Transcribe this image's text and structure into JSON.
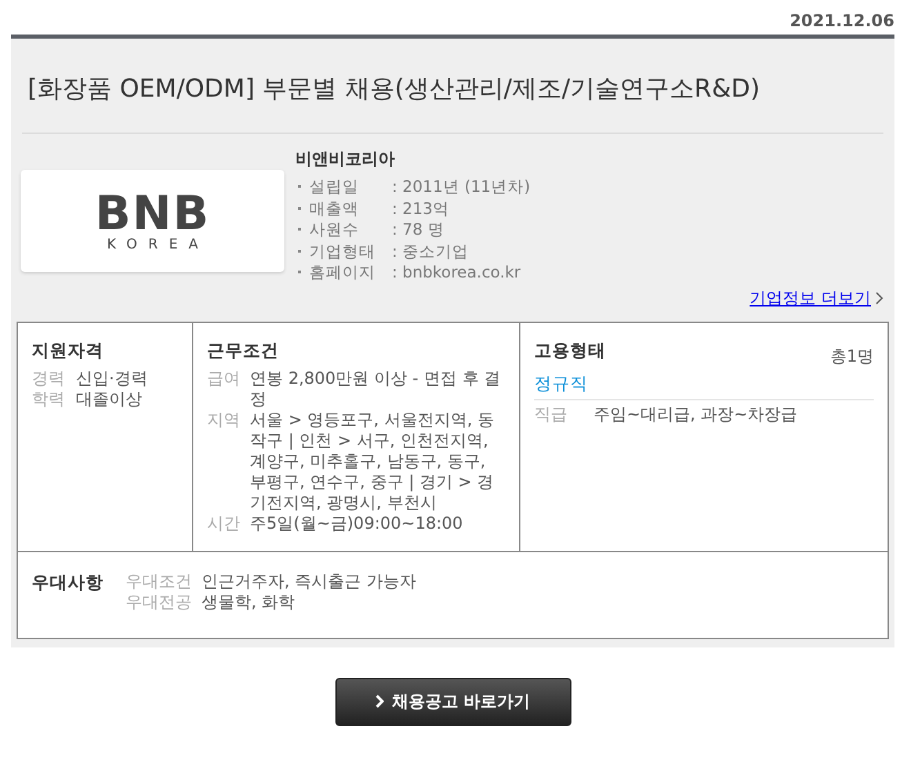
{
  "date": "2021.12.06",
  "title": "[화장품 OEM/ODM] 부문별 채용(생산관리/제조/기술연구소R&D)",
  "company": {
    "logo": {
      "name": "BNB",
      "sub": "KOREA"
    },
    "name": "비앤비코리아",
    "info": [
      {
        "label": "설립일",
        "value": ": 2011년 (11년차)"
      },
      {
        "label": "매출액",
        "value": ": 213억"
      },
      {
        "label": "사원수",
        "value": ": 78 명"
      },
      {
        "label": "기업형태",
        "value": ": 중소기업"
      },
      {
        "label": "홈페이지",
        "value": ": bnbkorea.co.kr"
      }
    ],
    "more_link": "기업정보 더보기"
  },
  "qualification": {
    "heading": "지원자격",
    "rows": [
      {
        "label": "경력",
        "value": "신입·경력"
      },
      {
        "label": "학력",
        "value": "대졸이상"
      }
    ]
  },
  "conditions": {
    "heading": "근무조건",
    "rows": [
      {
        "label": "급여",
        "value": "연봉 2,800만원 이상 - 면접 후 결정"
      },
      {
        "label": "지역",
        "value": "서울 > 영등포구, 서울전지역, 동작구 | 인천 > 서구, 인천전지역, 계양구, 미추홀구, 남동구, 동구, 부평구, 연수구, 중구 | 경기 > 경기전지역, 광명시, 부천시"
      },
      {
        "label": "시간",
        "value": "주5일(월~금)09:00~18:00"
      }
    ]
  },
  "employment": {
    "heading": "고용형태",
    "count": "총1명",
    "type": "정규직",
    "rows": [
      {
        "label": "직급",
        "value": "주임~대리급, 과장~차장급"
      }
    ]
  },
  "preference": {
    "heading": "우대사항",
    "rows": [
      {
        "label": "우대조건",
        "value": "인근거주자, 즉시출근 가능자"
      },
      {
        "label": "우대전공",
        "value": "생물학, 화학"
      }
    ]
  },
  "button": "채용공고 바로가기"
}
